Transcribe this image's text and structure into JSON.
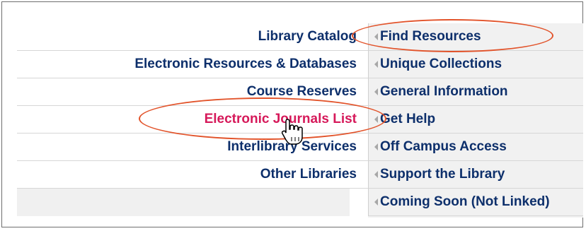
{
  "submenu": {
    "items": [
      {
        "label": "Library Catalog"
      },
      {
        "label": "Electronic Resources & Databases"
      },
      {
        "label": "Course Reserves"
      },
      {
        "label": "Electronic Journals List"
      },
      {
        "label": "Interlibrary Services"
      },
      {
        "label": "Other Libraries"
      }
    ]
  },
  "mainmenu": {
    "items": [
      {
        "label": "Find Resources"
      },
      {
        "label": "Unique Collections"
      },
      {
        "label": "General Information"
      },
      {
        "label": "Get Help"
      },
      {
        "label": "Off Campus Access"
      },
      {
        "label": "Support the Library"
      },
      {
        "label": "Coming Soon (Not Linked)"
      }
    ]
  },
  "colors": {
    "link": "#0d2f6b",
    "active_link": "#d6195a",
    "highlight_ellipse": "#e2532a"
  },
  "icons": {
    "menu_arrow": "left-triangle",
    "cursor": "hand-pointer"
  }
}
